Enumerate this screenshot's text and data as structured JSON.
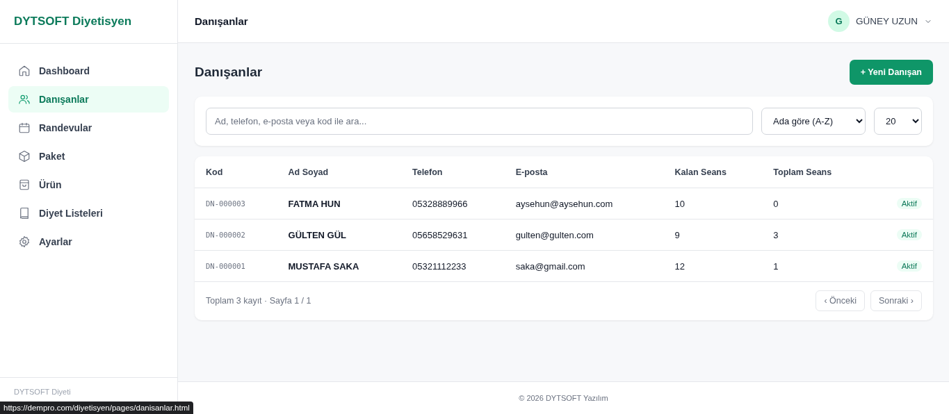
{
  "sidebar": {
    "brand": "DYTSOFT Diyetisyen",
    "items": [
      {
        "label": "Dashboard",
        "selected": false
      },
      {
        "label": "Danışanlar",
        "selected": true
      },
      {
        "label": "Randevular",
        "selected": false
      },
      {
        "label": "Paket",
        "selected": false
      },
      {
        "label": "Ürün",
        "selected": false
      },
      {
        "label": "Diyet Listeleri",
        "selected": false
      },
      {
        "label": "Ayarlar",
        "selected": false
      }
    ],
    "footer": "DYTSOFT Diyeti"
  },
  "header": {
    "title": "Danışanlar",
    "user": {
      "initial": "G",
      "name": "GÜNEY UZUN"
    }
  },
  "page": {
    "title": "Danışanlar",
    "new_button": "+ Yeni Danışan"
  },
  "filters": {
    "search": {
      "placeholder": "Ad, telefon, e-posta veya kod ile ara..."
    },
    "sort": "Ada göre (A-Z)",
    "page_size": "20"
  },
  "table": {
    "columns": [
      "Kod",
      "Ad Soyad",
      "Telefon",
      "E-posta",
      "Kalan Seans",
      "Toplam Seans"
    ],
    "rows": [
      {
        "code": "DN-000003",
        "name": "FATMA HUN",
        "phone": "05328889966",
        "email": "aysehun@aysehun.com",
        "remaining": "10",
        "total": "0",
        "status": "Aktif"
      },
      {
        "code": "DN-000002",
        "name": "GÜLTEN GÜL",
        "phone": "05658529631",
        "email": "gulten@gulten.com",
        "remaining": "9",
        "total": "3",
        "status": "Aktif"
      },
      {
        "code": "DN-000001",
        "name": "MUSTAFA SAKA",
        "phone": "05321112233",
        "email": "saka@gmail.com",
        "remaining": "12",
        "total": "1",
        "status": "Aktif"
      }
    ],
    "summary": "Toplam 3 kayıt · Sayfa 1 / 1",
    "prev": "‹ Önceki",
    "next": "Sonraki ›"
  },
  "footer": "© 2026 DYTSOFT Yazılım",
  "status_url": "https://dempro.com/diyetisyen/pages/danisanlar.html"
}
